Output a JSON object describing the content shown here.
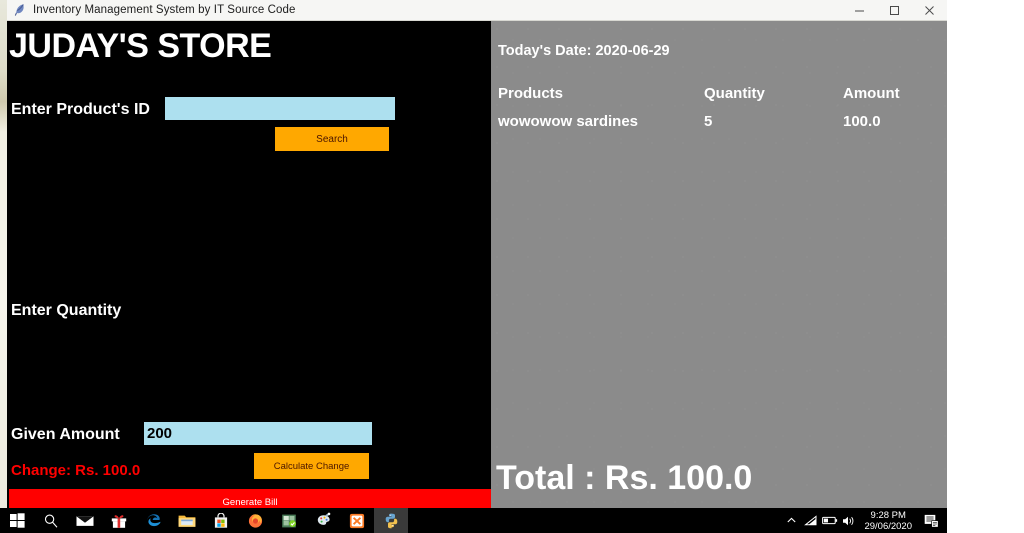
{
  "window": {
    "title": "Inventory Management System by IT Source Code",
    "icon": "feather-icon",
    "controls": {
      "minimize": "minimize-icon",
      "maximize": "maximize-icon",
      "close": "close-icon"
    }
  },
  "left_panel": {
    "store_title": "JUDAY'S STORE",
    "product_id": {
      "label": "Enter Product's ID",
      "value": "",
      "placeholder": ""
    },
    "search_button": "Search",
    "quantity": {
      "label": "Enter Quantity",
      "value": "",
      "placeholder": ""
    },
    "given_amount": {
      "label": "Given Amount",
      "value": "200",
      "placeholder": ""
    },
    "change_text": "Change: Rs. 100.0",
    "calculate_change_button": "Calculate Change",
    "generate_bill_button": "Generate Bill"
  },
  "right_panel": {
    "todays_date": "Today's Date: 2020-06-29",
    "columns": [
      "Products",
      "Quantity",
      "Amount"
    ],
    "rows": [
      {
        "product": "wowowow sardines",
        "quantity": "5",
        "amount": "100.0"
      }
    ],
    "total": "Total : Rs. 100.0"
  },
  "taskbar": {
    "items": [
      {
        "name": "start-button",
        "icon": "windows-logo-icon"
      },
      {
        "name": "search-button",
        "icon": "search-icon"
      },
      {
        "name": "mail-app",
        "icon": "mail-icon"
      },
      {
        "name": "gift-app",
        "icon": "gift-icon"
      },
      {
        "name": "edge-browser",
        "icon": "edge-icon"
      },
      {
        "name": "file-explorer",
        "icon": "folder-icon"
      },
      {
        "name": "microsoft-store",
        "icon": "store-bag-icon"
      },
      {
        "name": "firefox-browser",
        "icon": "firefox-icon"
      },
      {
        "name": "spreadsheet-app",
        "icon": "spreadsheet-icon"
      },
      {
        "name": "paint-app",
        "icon": "paint-palette-icon"
      },
      {
        "name": "xampp-app",
        "icon": "xampp-icon"
      },
      {
        "name": "python-app",
        "icon": "python-icon"
      }
    ],
    "tray": {
      "chevron": "chevron-up-icon",
      "network": "wifi-icon",
      "battery": "battery-icon",
      "volume": "volume-icon",
      "time": "9:28 PM",
      "date": "29/06/2020",
      "action_center": "notification-icon"
    }
  },
  "colors": {
    "panel_dark": "#000000",
    "panel_gray": "#8b8b8b",
    "accent_orange": "#ffa800",
    "accent_red": "#ff0000",
    "input_blue": "#ade0ef"
  }
}
